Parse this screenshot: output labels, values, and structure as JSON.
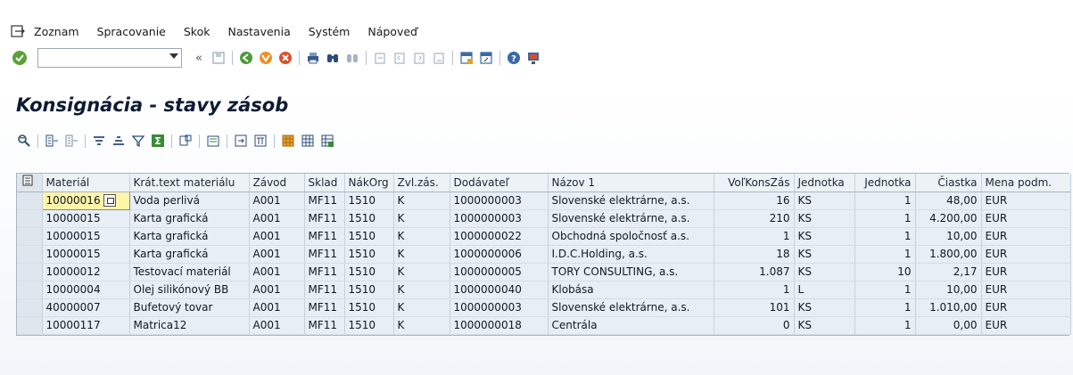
{
  "menu": {
    "items": [
      {
        "label": "Zoznam"
      },
      {
        "label": "Spracovanie"
      },
      {
        "label": "Skok"
      },
      {
        "label": "Nastavenia"
      },
      {
        "label": "Systém"
      },
      {
        "label": "Nápoveď"
      }
    ]
  },
  "toolbar": {
    "command_field_value": "",
    "icons": [
      "ok-icon",
      "back-double-icon",
      "save-icon",
      "back-icon",
      "exit-icon",
      "cancel-icon",
      "print-icon",
      "find-icon",
      "find-next-icon",
      "first-page-icon",
      "prev-page-icon",
      "next-page-icon",
      "last-page-icon",
      "new-session-icon",
      "shortcut-icon",
      "help-icon",
      "customize-layout-icon"
    ]
  },
  "page": {
    "title": "Konsignácia - stavy zásob"
  },
  "app_toolbar": {
    "icons": [
      "details-icon",
      "select-all-icon",
      "deselect-all-icon",
      "sort-ascending-icon",
      "sort-descending-icon",
      "filter-icon",
      "total-icon",
      "subtotal-icon",
      "export-icon",
      "print-preview-icon",
      "abc-analysis-icon",
      "choose-layout-icon",
      "change-layout-icon",
      "save-layout-icon"
    ]
  },
  "grid": {
    "columns": [
      "Materiál",
      "Krát.text materiálu",
      "Závod",
      "Sklad",
      "NákOrg",
      "Zvl.zás.",
      "Dodávateľ",
      "Názov 1",
      "VoľKonsZás",
      "Jednotka",
      "Jednotka",
      "Čiastka",
      "Mena podm."
    ],
    "rows": [
      [
        "10000016",
        "Voda perlivá",
        "A001",
        "MF11",
        "1510",
        "K",
        "1000000003",
        "Slovenské elektrárne, a.s.",
        "16",
        "KS",
        "1",
        "48,00",
        "EUR"
      ],
      [
        "10000015",
        "Karta grafická",
        "A001",
        "MF11",
        "1510",
        "K",
        "1000000003",
        "Slovenské elektrárne, a.s.",
        "210",
        "KS",
        "1",
        "4.200,00",
        "EUR"
      ],
      [
        "10000015",
        "Karta grafická",
        "A001",
        "MF11",
        "1510",
        "K",
        "1000000022",
        "Obchodná spoločnosť a.s.",
        "1",
        "KS",
        "1",
        "10,00",
        "EUR"
      ],
      [
        "10000015",
        "Karta grafická",
        "A001",
        "MF11",
        "1510",
        "K",
        "1000000006",
        "I.D.C.Holding, a.s.",
        "18",
        "KS",
        "1",
        "1.800,00",
        "EUR"
      ],
      [
        "10000012",
        "Testovací materiál",
        "A001",
        "MF11",
        "1510",
        "K",
        "1000000005",
        "TORY CONSULTING, a.s.",
        "1.087",
        "KS",
        "10",
        "2,17",
        "EUR"
      ],
      [
        "10000004",
        "Olej silikónový BB",
        "A001",
        "MF11",
        "1510",
        "K",
        "1000000040",
        "Klobása",
        "1",
        "L",
        "1",
        "10,00",
        "EUR"
      ],
      [
        "40000007",
        "Bufetový tovar",
        "A001",
        "MF11",
        "1510",
        "K",
        "1000000003",
        "Slovenské elektrárne, a.s.",
        "101",
        "KS",
        "1",
        "1.010,00",
        "EUR"
      ],
      [
        "10000117",
        "Matrica12",
        "A001",
        "MF11",
        "1510",
        "K",
        "1000000018",
        "Centrála",
        "0",
        "KS",
        "1",
        "0,00",
        "EUR"
      ]
    ]
  },
  "colors": {
    "title": "#0e1b33",
    "grid_cell": "#e8eef5",
    "focus_cell": "#fff4a8",
    "ok_green": "#5aa13a"
  }
}
